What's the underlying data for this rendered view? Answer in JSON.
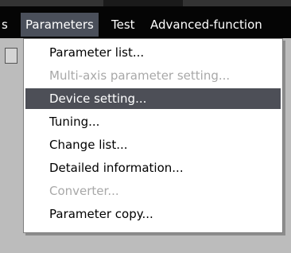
{
  "menubar": {
    "items": [
      {
        "label": "s"
      },
      {
        "label": "Parameters"
      },
      {
        "label": "Test"
      },
      {
        "label": "Advanced-function"
      }
    ]
  },
  "dropdown": {
    "items": [
      {
        "label": "Parameter list...",
        "enabled": true,
        "highlighted": false
      },
      {
        "label": "Multi-axis parameter setting...",
        "enabled": false,
        "highlighted": false
      },
      {
        "label": "Device setting...",
        "enabled": true,
        "highlighted": true
      },
      {
        "label": "Tuning...",
        "enabled": true,
        "highlighted": false
      },
      {
        "label": "Change list...",
        "enabled": true,
        "highlighted": false
      },
      {
        "label": "Detailed information...",
        "enabled": true,
        "highlighted": false
      },
      {
        "label": "Converter...",
        "enabled": false,
        "highlighted": false
      },
      {
        "label": "Parameter copy...",
        "enabled": true,
        "highlighted": false
      }
    ]
  }
}
